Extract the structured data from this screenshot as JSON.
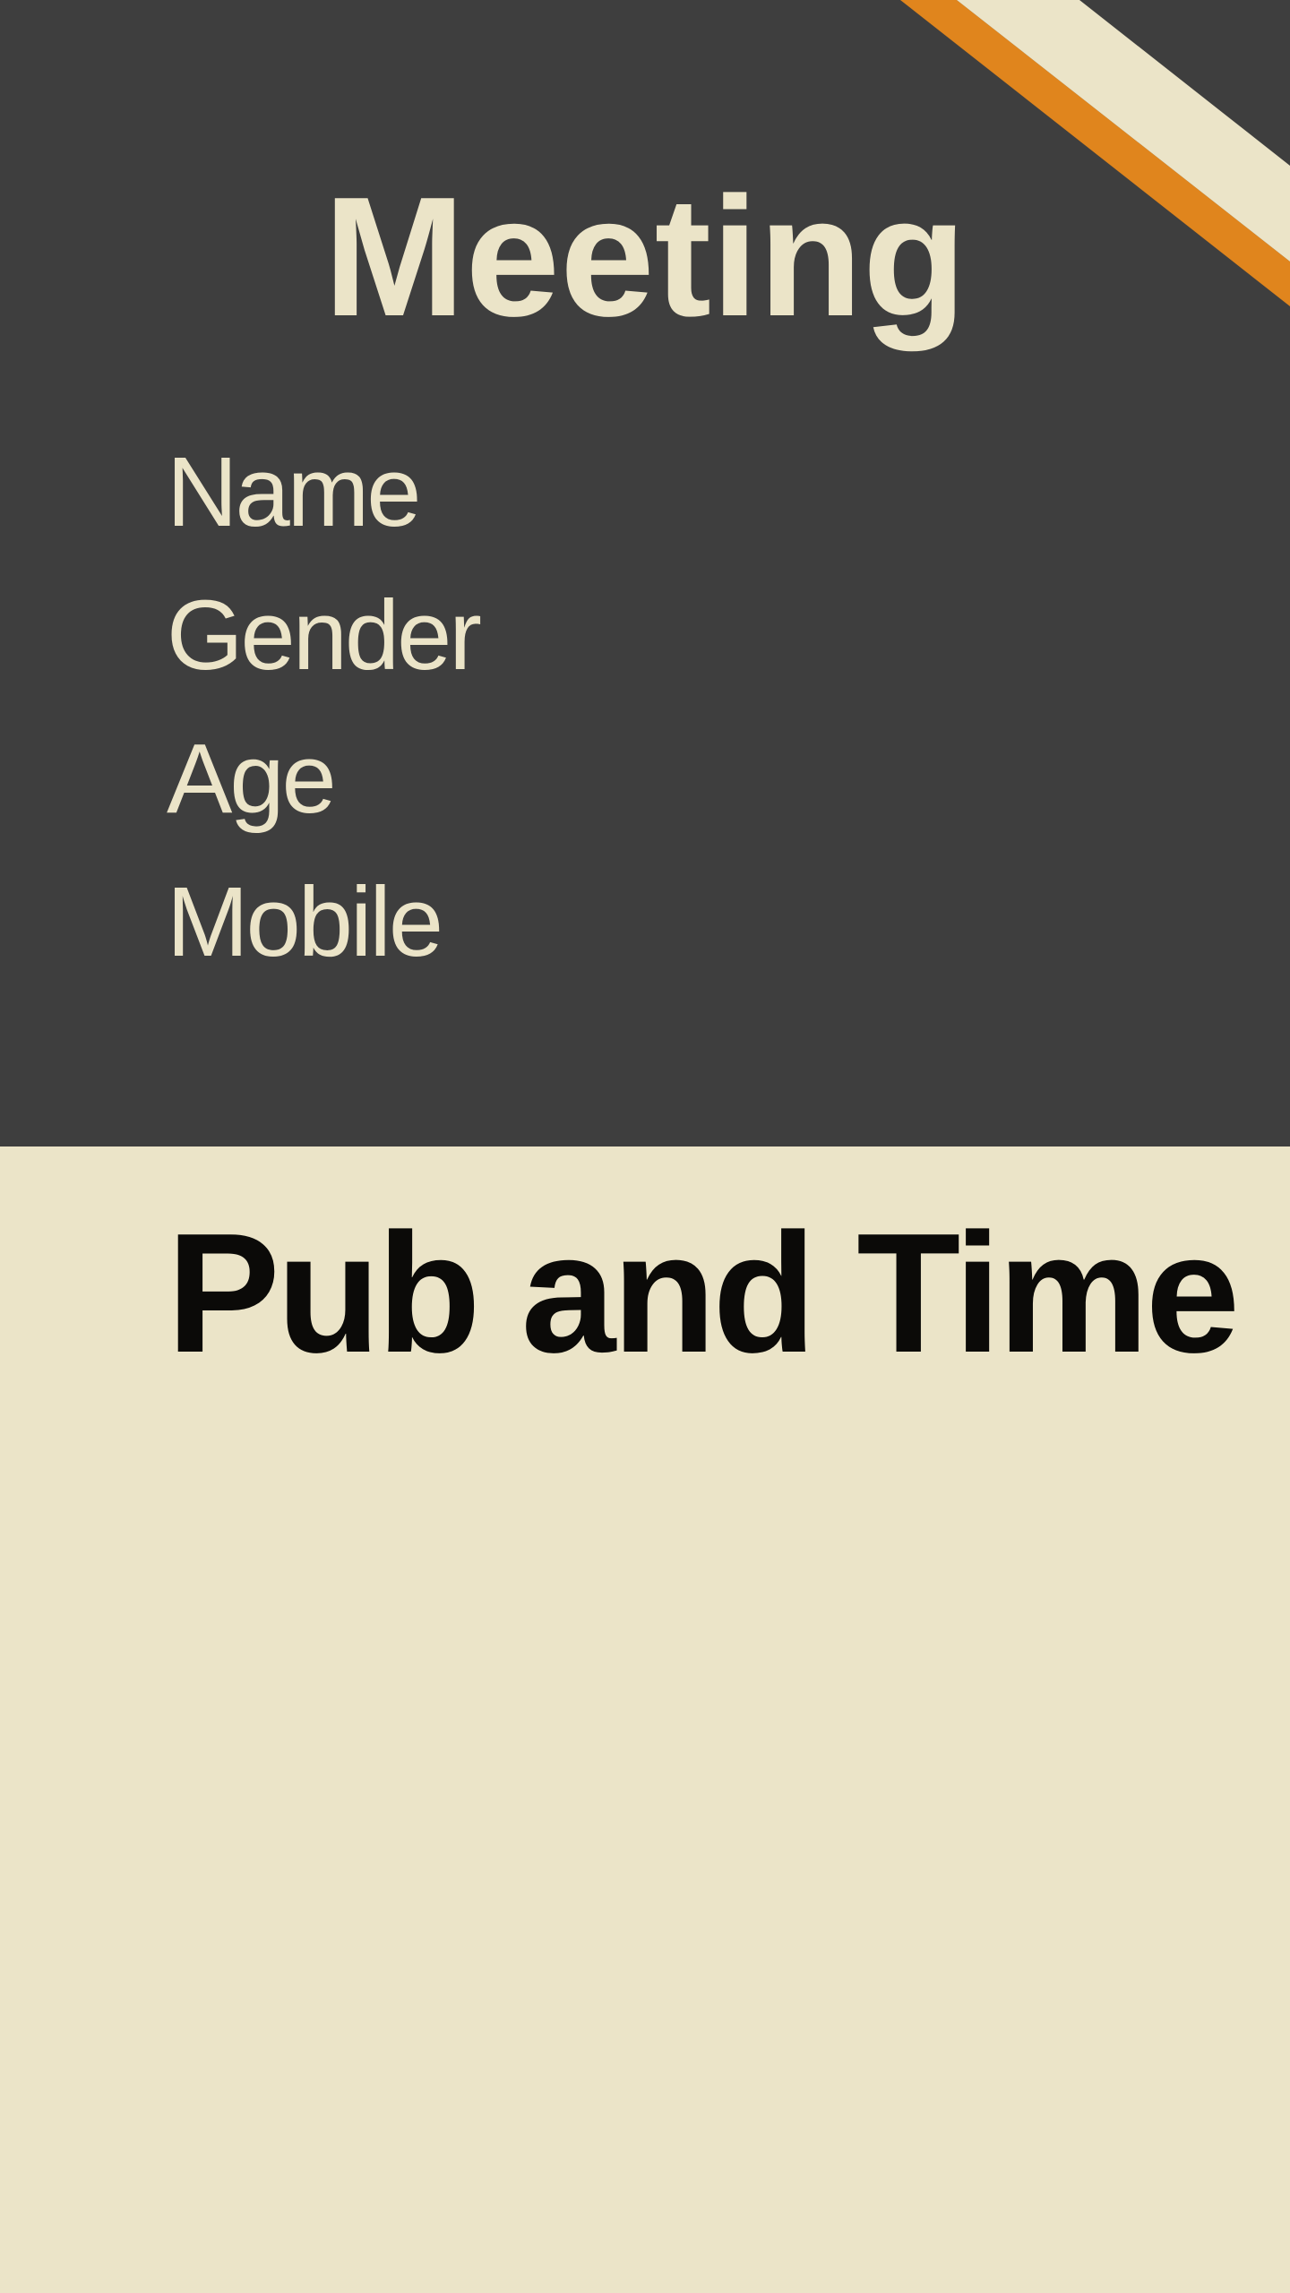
{
  "header": {
    "title": "Meeting"
  },
  "form": {
    "fields": [
      {
        "label": "Name"
      },
      {
        "label": "Gender"
      },
      {
        "label": "Age"
      },
      {
        "label": "Mobile"
      }
    ]
  },
  "section": {
    "heading": "Pub and Time"
  },
  "colors": {
    "dark_panel": "#3e3e3e",
    "cream": "#ebe4c8",
    "accent_orange": "#e0851d",
    "text_dark": "#0b0a08"
  }
}
